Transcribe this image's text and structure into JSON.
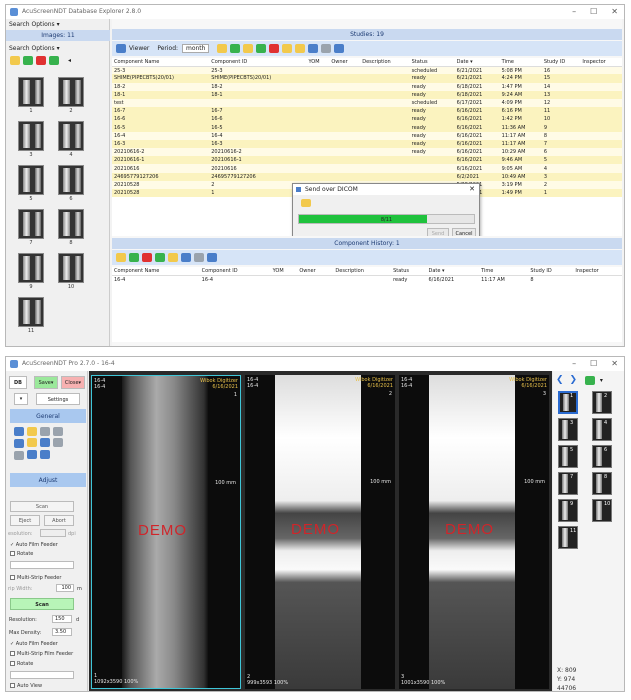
{
  "top": {
    "title": "AcuScreenNDT Database Explorer 2.8.0",
    "left": {
      "search_options": "Search Options ▾",
      "images_header": "Images: 11",
      "search_options2": "Search Options ▾",
      "thumb_labels": [
        "1",
        "2",
        "3",
        "4",
        "5",
        "6",
        "7",
        "8",
        "9",
        "10",
        "11"
      ]
    },
    "studies_header": "Studies: 19",
    "toolbar": {
      "viewer": "Viewer",
      "period": "Period:",
      "period_value": "month"
    },
    "columns": [
      "Component Name",
      "Component ID",
      "YOM",
      "Owner",
      "Description",
      "Status",
      "Date ▾",
      "Time",
      "Study ID",
      "Inspector"
    ],
    "rows": [
      [
        "25-3",
        "25-3",
        "",
        "",
        "",
        "scheduled",
        "6/21/2021",
        "5:08 PM",
        "16",
        ""
      ],
      [
        "SHIME(PIPECBTS)20/01)",
        "SHIME(PIPECBTS)20/01)",
        "",
        "",
        "",
        "ready",
        "6/21/2021",
        "4:24 PM",
        "15",
        ""
      ],
      [
        "18-2",
        "18-2",
        "",
        "",
        "",
        "ready",
        "6/18/2021",
        "1:47 PM",
        "14",
        ""
      ],
      [
        "18-1",
        "18-1",
        "",
        "",
        "",
        "ready",
        "6/18/2021",
        "9:24 AM",
        "13",
        ""
      ],
      [
        "test",
        "",
        "",
        "",
        "",
        "scheduled",
        "6/17/2021",
        "4:09 PM",
        "12",
        ""
      ],
      [
        "16-7",
        "16-7",
        "",
        "",
        "",
        "ready",
        "6/16/2021",
        "6:16 PM",
        "11",
        ""
      ],
      [
        "16-6",
        "16-6",
        "",
        "",
        "",
        "ready",
        "6/16/2021",
        "1:42 PM",
        "10",
        ""
      ],
      [
        "16-5",
        "16-5",
        "",
        "",
        "",
        "ready",
        "6/16/2021",
        "11:36 AM",
        "9",
        ""
      ],
      [
        "16-4",
        "16-4",
        "",
        "",
        "",
        "ready",
        "6/16/2021",
        "11:17 AM",
        "8",
        ""
      ],
      [
        "16-3",
        "16-3",
        "",
        "",
        "",
        "ready",
        "6/16/2021",
        "11:17 AM",
        "7",
        ""
      ],
      [
        "20210616-2",
        "20210616-2",
        "",
        "",
        "",
        "ready",
        "6/16/2021",
        "10:29 AM",
        "6",
        ""
      ],
      [
        "20210616-1",
        "20210616-1",
        "",
        "",
        "",
        "",
        "6/16/2021",
        "9:46 AM",
        "5",
        ""
      ],
      [
        "20210616",
        "20210616",
        "",
        "",
        "",
        "",
        "6/16/2021",
        "9:05 AM",
        "4",
        ""
      ],
      [
        "24695779127206",
        "24695779127206",
        "",
        "",
        "",
        "",
        "6/2/2021",
        "10:49 AM",
        "3",
        ""
      ],
      [
        "20210528",
        "2",
        "",
        "",
        "",
        "",
        "5/28/2021",
        "3:19 PM",
        "2",
        ""
      ],
      [
        "20210528",
        "1",
        "",
        "",
        "",
        "",
        "5/28/2021",
        "1:49 PM",
        "1",
        ""
      ]
    ],
    "dialog": {
      "title": "Send over DICOM",
      "progress_text": "8/11",
      "progress": 0.73,
      "send": "Send",
      "cancel": "Cancel"
    },
    "history_header": "Component History: 1",
    "history_columns": [
      "Component Name",
      "Component ID",
      "YOM",
      "Owner",
      "Description",
      "Status",
      "Date ▾",
      "Time",
      "Study ID",
      "Inspector"
    ],
    "history_row": [
      "16-4",
      "16-4",
      "",
      "",
      "",
      "ready",
      "6/16/2021",
      "11:17 AM",
      "8",
      ""
    ]
  },
  "bottom": {
    "title": "AcuScreenNDT Pro 2.7.0 - 16-4",
    "top_buttons": {
      "db": "DB",
      "save": "Save▾",
      "close": "Close▾",
      "settings": "Settings"
    },
    "general": "General",
    "adjust": "Adjust",
    "scan": "Scan",
    "eject": "Eject",
    "abort": "Abort",
    "resolution_short": "esolution:",
    "dpi": "dpi",
    "auto_film_feeder": "Auto Film Feeder",
    "rotate": "Rotate",
    "multi_strip": "Multi-Strip Feeder",
    "strip_width": "rip Width:",
    "strip_width_value": "100",
    "strip_unit": "m",
    "scan_main": "Scan",
    "resolution": "Resolution:",
    "resolution_value": "150",
    "resolution_unit": "d",
    "max_density": "Max Density:",
    "max_density_value": "3.50",
    "auto_film_feeder2": "Auto Film Feeder",
    "multi_strip2": "Multi-Strip Film Feeder",
    "rotate2": "Rotate",
    "auto_view": "Auto View",
    "panels": [
      {
        "tl": "16-4\n16-4",
        "tr": "Wibok Digitizer\n6/16/2021",
        "num": "1",
        "bl": "1\n1092x3590 100%",
        "demo": "DEMO",
        "scale": "100 mm"
      },
      {
        "tl": "16-4\n16-4",
        "tr": "Wibok Digitizer\n6/16/2021",
        "num": "2",
        "bl": "2\n999x3593 100%",
        "demo": "DEMO",
        "scale": "100 mm"
      },
      {
        "tl": "16-4\n16-4",
        "tr": "Wibok Digitizer\n6/16/2021",
        "num": "3",
        "bl": "3\n1001x3590 100%",
        "demo": "DEMO",
        "scale": "100 mm"
      }
    ],
    "right_thumbs": [
      "1",
      "2",
      "3",
      "4",
      "5",
      "6",
      "7",
      "8",
      "9",
      "10",
      "11"
    ],
    "coords": {
      "x": "X: 809",
      "y": "Y: 974",
      "v": "44706"
    }
  }
}
